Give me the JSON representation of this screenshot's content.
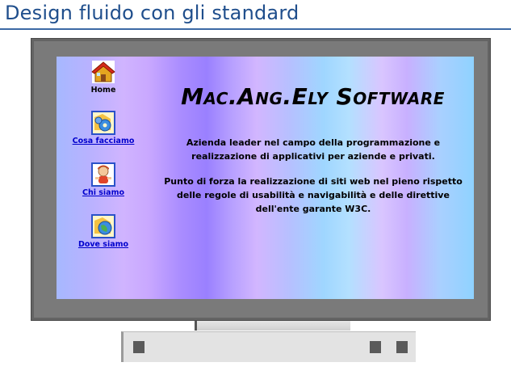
{
  "slide": {
    "title": "Design fluido con gli standard"
  },
  "site": {
    "brand": "Mac.Ang.Ely Software",
    "nav": [
      {
        "label": "Home",
        "icon": "home-icon"
      },
      {
        "label": "Cosa facciamo",
        "icon": "gears-icon"
      },
      {
        "label": "Chi siamo",
        "icon": "person-icon"
      },
      {
        "label": "Dove siamo",
        "icon": "globe-icon"
      }
    ],
    "description": [
      "Azienda leader nel campo della programmazione e realizzazione di applicativi per aziende e privati.",
      "Punto di forza la realizzazione di siti web nel pieno rispetto delle regole di usabilità e navigabilità e delle direttive dell'ente garante W3C."
    ]
  },
  "colors": {
    "title": "#1f4e8c",
    "link": "#0000cc",
    "frame": "#646464"
  }
}
